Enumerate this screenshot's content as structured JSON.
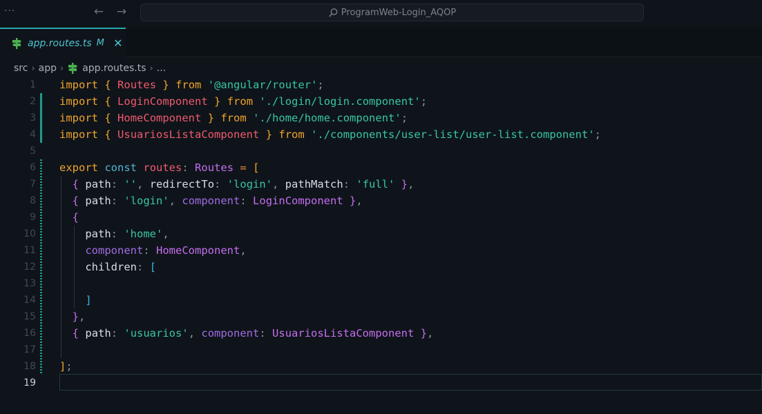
{
  "titlebar": {
    "menu_dots": "···",
    "back_arrow": "←",
    "forward_arrow": "→",
    "command_center": "ProgramWeb-Login_AQOP"
  },
  "tab": {
    "label": "app.routes.ts",
    "badge": "M",
    "close": "✕"
  },
  "breadcrumb": {
    "items": [
      "src",
      "app",
      "app.routes.ts",
      "..."
    ]
  },
  "editor": {
    "active_line": "19",
    "lines": [
      {
        "n": "1",
        "tokens": [
          [
            "kw",
            "import"
          ],
          [
            "pu",
            " "
          ],
          [
            "br",
            "{"
          ],
          [
            "pu",
            " "
          ],
          [
            "ty",
            "Routes"
          ],
          [
            "pu",
            " "
          ],
          [
            "br",
            "}"
          ],
          [
            "pu",
            " "
          ],
          [
            "kw",
            "from"
          ],
          [
            "pu",
            " "
          ],
          [
            "st",
            "'@angular/router'"
          ],
          [
            "pu",
            ";"
          ]
        ]
      },
      {
        "n": "2",
        "tokens": [
          [
            "kw",
            "import"
          ],
          [
            "pu",
            " "
          ],
          [
            "br",
            "{"
          ],
          [
            "pu",
            " "
          ],
          [
            "ty",
            "LoginComponent"
          ],
          [
            "pu",
            " "
          ],
          [
            "br",
            "}"
          ],
          [
            "pu",
            " "
          ],
          [
            "kw",
            "from"
          ],
          [
            "pu",
            " "
          ],
          [
            "st",
            "'./login/login.component'"
          ],
          [
            "pu",
            ";"
          ]
        ]
      },
      {
        "n": "3",
        "tokens": [
          [
            "kw",
            "import"
          ],
          [
            "pu",
            " "
          ],
          [
            "br",
            "{"
          ],
          [
            "pu",
            " "
          ],
          [
            "ty",
            "HomeComponent"
          ],
          [
            "pu",
            " "
          ],
          [
            "br",
            "}"
          ],
          [
            "pu",
            " "
          ],
          [
            "kw",
            "from"
          ],
          [
            "pu",
            " "
          ],
          [
            "st",
            "'./home/home.component'"
          ],
          [
            "pu",
            ";"
          ]
        ]
      },
      {
        "n": "4",
        "tokens": [
          [
            "kw",
            "import"
          ],
          [
            "pu",
            " "
          ],
          [
            "br",
            "{"
          ],
          [
            "pu",
            " "
          ],
          [
            "ty",
            "UsuariosListaComponent"
          ],
          [
            "pu",
            " "
          ],
          [
            "br",
            "}"
          ],
          [
            "pu",
            " "
          ],
          [
            "kw",
            "from"
          ],
          [
            "pu",
            " "
          ],
          [
            "st",
            "'./components/user-list/user-list.component'"
          ],
          [
            "pu",
            ";"
          ]
        ]
      },
      {
        "n": "5",
        "tokens": []
      },
      {
        "n": "6",
        "tokens": [
          [
            "kw",
            "export"
          ],
          [
            "pu",
            " "
          ],
          [
            "kw2",
            "const"
          ],
          [
            "pu",
            " "
          ],
          [
            "vr",
            "routes"
          ],
          [
            "pu",
            ": "
          ],
          [
            "tv",
            "Routes"
          ],
          [
            "pu",
            " "
          ],
          [
            "pk",
            "="
          ],
          [
            "pu",
            " "
          ],
          [
            "br",
            "["
          ]
        ]
      },
      {
        "n": "7",
        "tokens": [
          [
            "pu",
            "  "
          ],
          [
            "bp",
            "{"
          ],
          [
            "pu",
            " "
          ],
          [
            "pr",
            "path"
          ],
          [
            "pu",
            ": "
          ],
          [
            "st",
            "''"
          ],
          [
            "pu",
            ", "
          ],
          [
            "pr",
            "redirectTo"
          ],
          [
            "pu",
            ": "
          ],
          [
            "st",
            "'login'"
          ],
          [
            "pu",
            ", "
          ],
          [
            "pr",
            "pathMatch"
          ],
          [
            "pu",
            ": "
          ],
          [
            "st",
            "'full'"
          ],
          [
            "pu",
            " "
          ],
          [
            "bp",
            "}"
          ],
          [
            "pu",
            ","
          ]
        ]
      },
      {
        "n": "8",
        "tokens": [
          [
            "pu",
            "  "
          ],
          [
            "bp",
            "{"
          ],
          [
            "pu",
            " "
          ],
          [
            "pr",
            "path"
          ],
          [
            "pu",
            ": "
          ],
          [
            "st",
            "'login'"
          ],
          [
            "pu",
            ", "
          ],
          [
            "pc",
            "component"
          ],
          [
            "pu",
            ": "
          ],
          [
            "tv",
            "LoginComponent"
          ],
          [
            "pu",
            " "
          ],
          [
            "bp",
            "}"
          ],
          [
            "pu",
            ","
          ]
        ]
      },
      {
        "n": "9",
        "tokens": [
          [
            "pu",
            "  "
          ],
          [
            "bp",
            "{"
          ]
        ]
      },
      {
        "n": "10",
        "tokens": [
          [
            "pu",
            "    "
          ],
          [
            "pr",
            "path"
          ],
          [
            "pu",
            ": "
          ],
          [
            "st",
            "'home'"
          ],
          [
            "pu",
            ","
          ]
        ]
      },
      {
        "n": "11",
        "tokens": [
          [
            "pu",
            "    "
          ],
          [
            "pc",
            "component"
          ],
          [
            "pu",
            ": "
          ],
          [
            "tv",
            "HomeComponent"
          ],
          [
            "pu",
            ","
          ]
        ]
      },
      {
        "n": "12",
        "tokens": [
          [
            "pu",
            "    "
          ],
          [
            "pr",
            "children"
          ],
          [
            "pu",
            ": "
          ],
          [
            "bb",
            "["
          ]
        ]
      },
      {
        "n": "13",
        "tokens": []
      },
      {
        "n": "14",
        "tokens": [
          [
            "pu",
            "    "
          ],
          [
            "bb",
            "]"
          ]
        ]
      },
      {
        "n": "15",
        "tokens": [
          [
            "pu",
            "  "
          ],
          [
            "bp",
            "}"
          ],
          [
            "pu",
            ","
          ]
        ]
      },
      {
        "n": "16",
        "tokens": [
          [
            "pu",
            "  "
          ],
          [
            "bp",
            "{"
          ],
          [
            "pu",
            " "
          ],
          [
            "pr",
            "path"
          ],
          [
            "pu",
            ": "
          ],
          [
            "st",
            "'usuarios'"
          ],
          [
            "pu",
            ", "
          ],
          [
            "pc",
            "component"
          ],
          [
            "pu",
            ": "
          ],
          [
            "tv",
            "UsuariosListaComponent"
          ],
          [
            "pu",
            " "
          ],
          [
            "bp",
            "}"
          ],
          [
            "pu",
            ","
          ]
        ]
      },
      {
        "n": "17",
        "tokens": []
      },
      {
        "n": "18",
        "tokens": [
          [
            "br",
            "]"
          ],
          [
            "pu",
            ";"
          ]
        ]
      },
      {
        "n": "19",
        "tokens": []
      }
    ]
  },
  "colors": {
    "accent": "#27aab0",
    "keyword": "#f0a52c",
    "string": "#37c6a4",
    "type": "#ef5a6f",
    "property_component": "#c46ef0"
  }
}
